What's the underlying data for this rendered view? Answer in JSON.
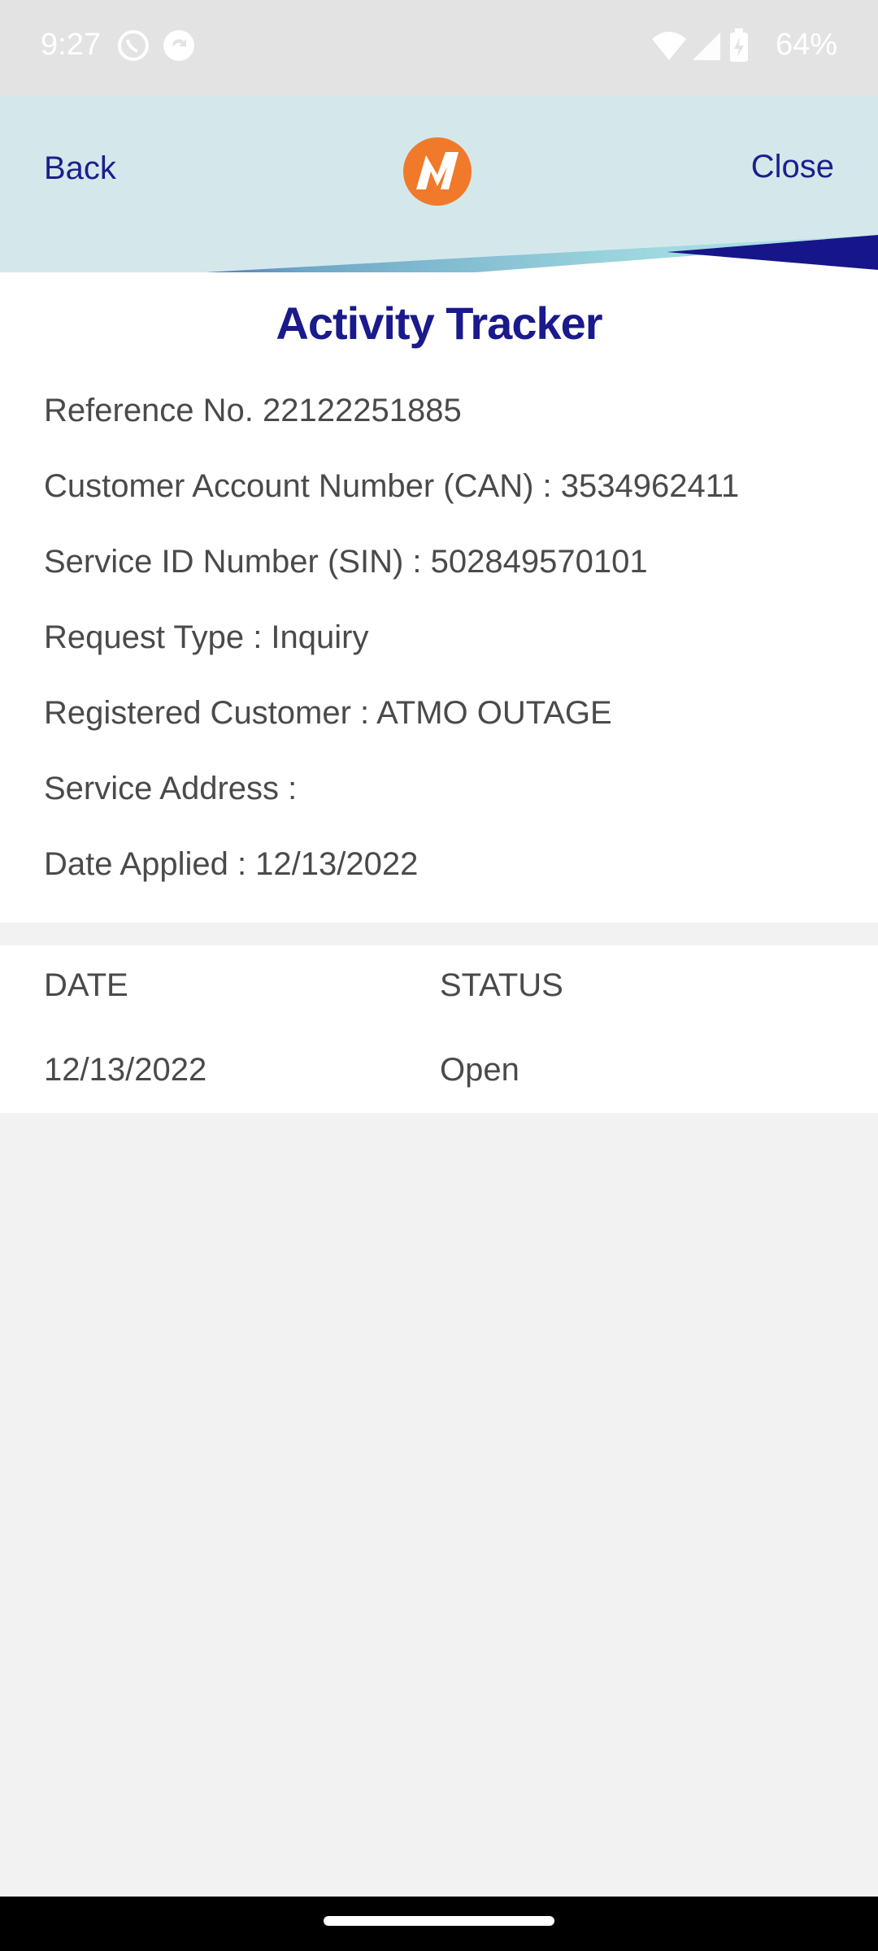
{
  "status_bar": {
    "time": "9:27",
    "battery_percent": "64%"
  },
  "header": {
    "back_label": "Back",
    "close_label": "Close",
    "logo_icon": "meralco-logo-icon",
    "colors": {
      "navy": "#1a1a8c",
      "teal": "#8ccfd6",
      "header_bg": "#d4e8ec",
      "logo_orange": "#f07a2a"
    }
  },
  "page": {
    "title": "Activity Tracker"
  },
  "details": {
    "reference": "Reference No. 22122251885",
    "can": "Customer Account Number (CAN) : 3534962411",
    "sin": "Service ID Number (SIN) : 502849570101",
    "request_type": "Request Type : Inquiry",
    "registered_customer": "Registered Customer : ATMO OUTAGE",
    "service_address": "Service Address :",
    "date_applied": "Date Applied : 12/13/2022"
  },
  "table": {
    "headers": {
      "date": "DATE",
      "status": "STATUS"
    },
    "rows": [
      {
        "date": "12/13/2022",
        "status": "Open"
      }
    ]
  }
}
